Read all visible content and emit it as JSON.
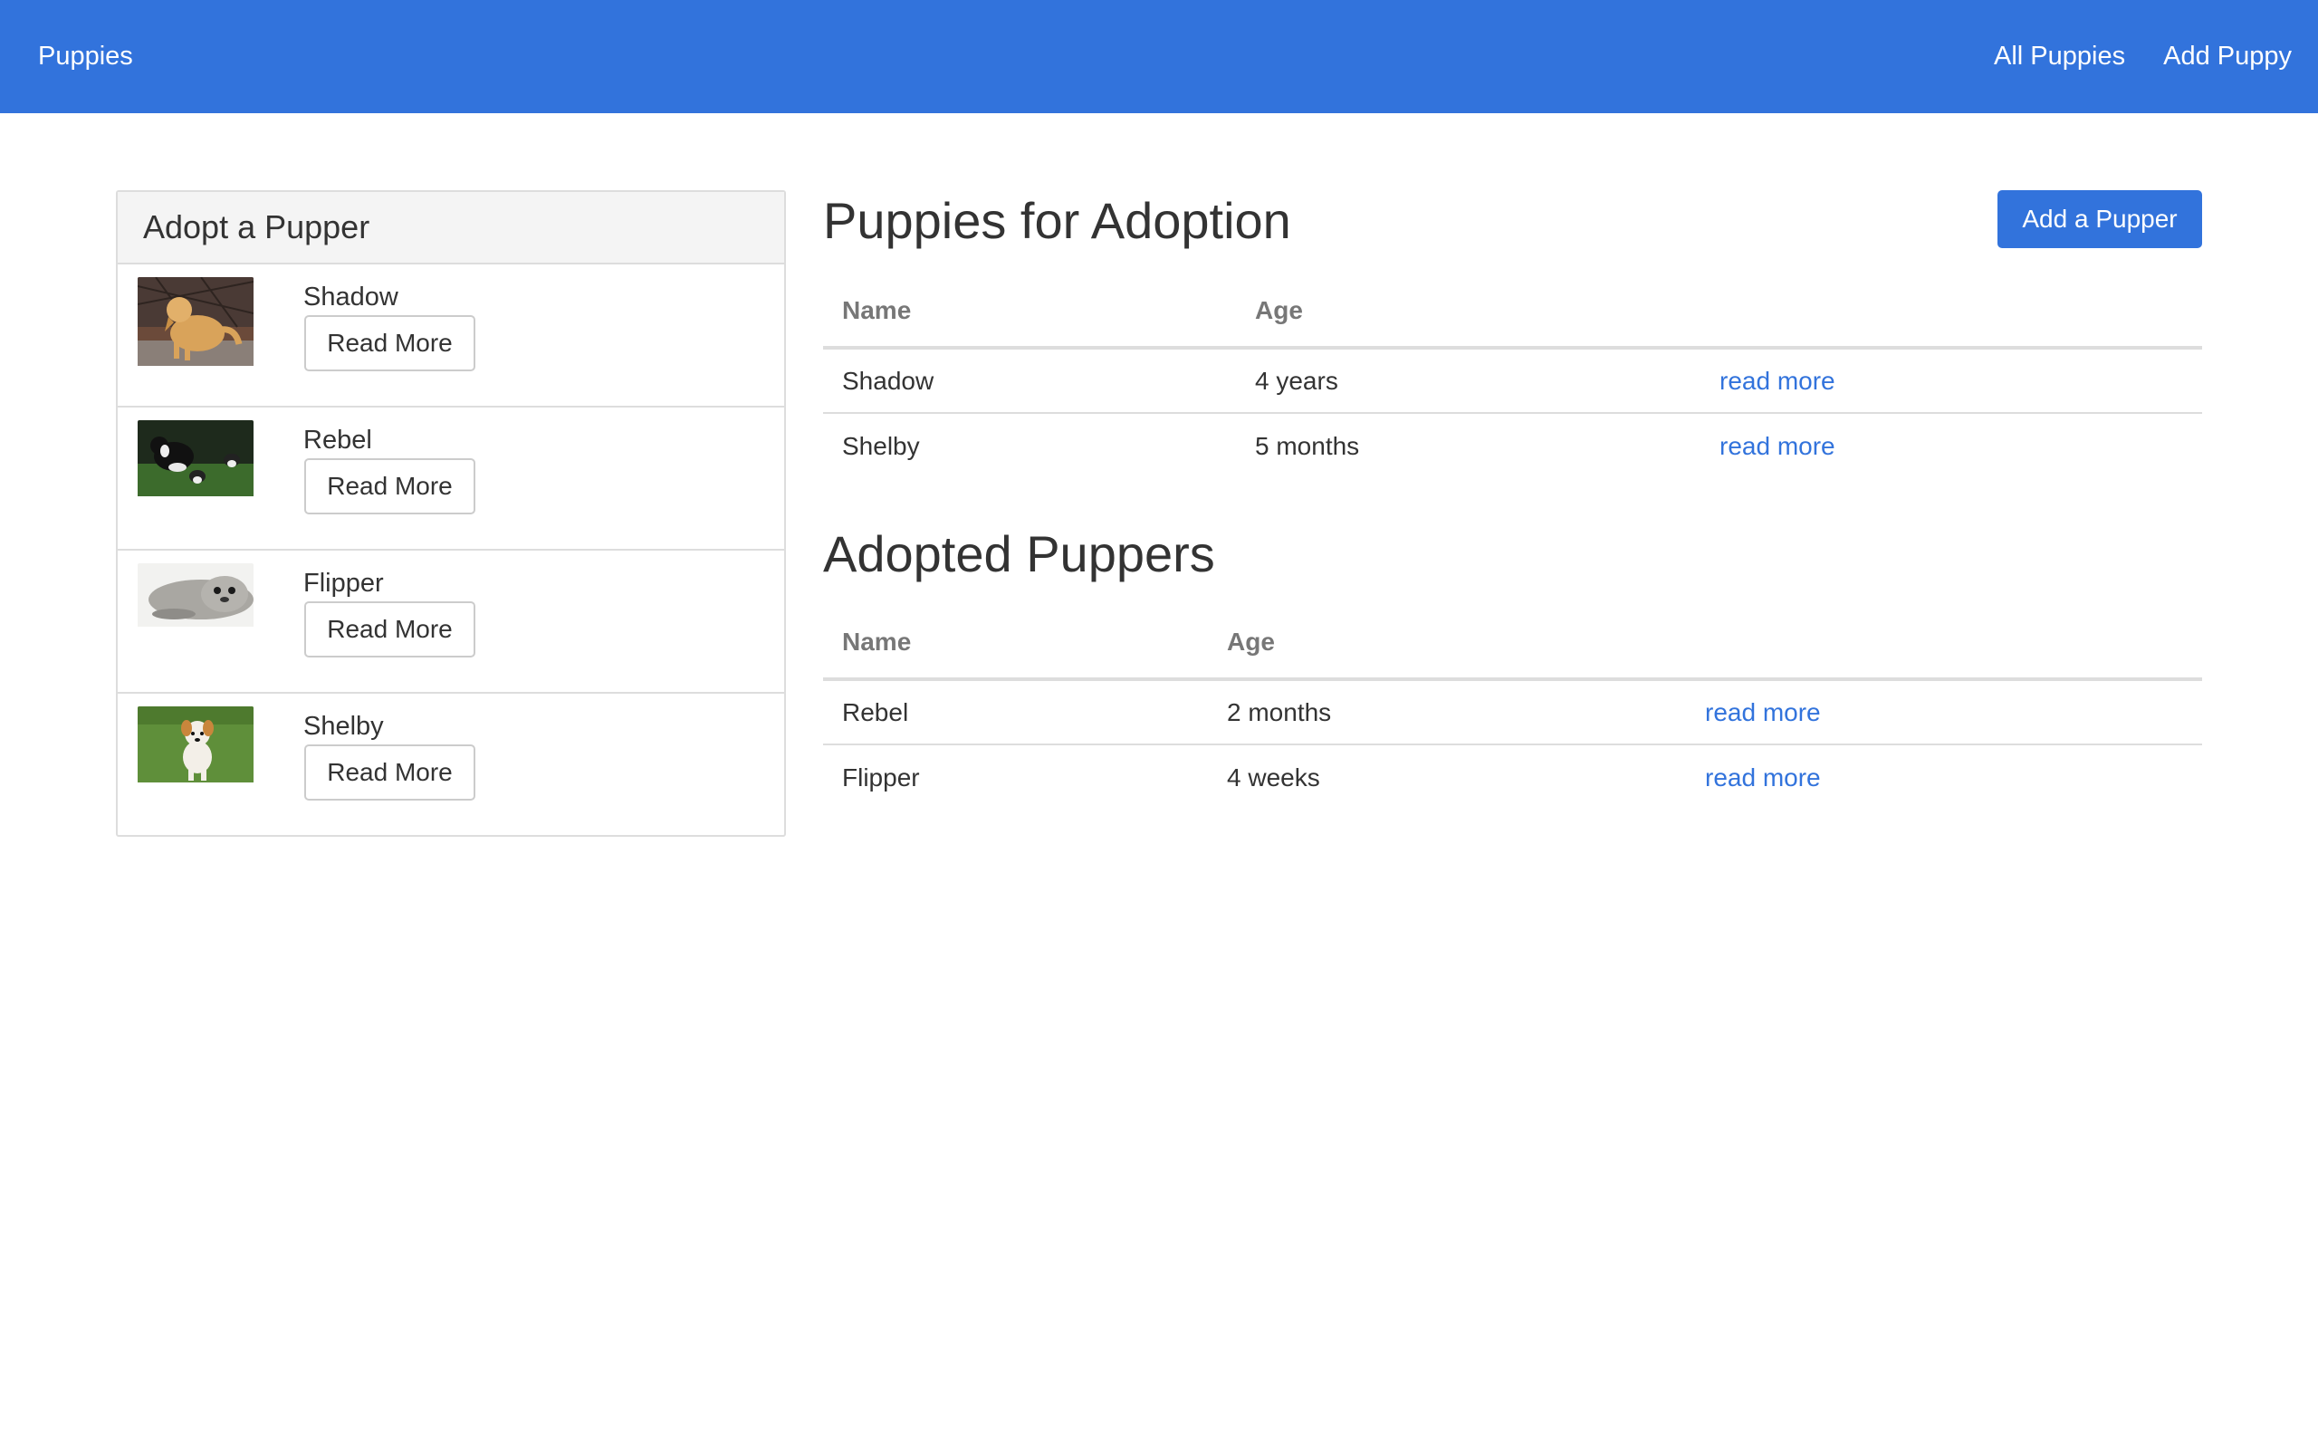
{
  "navbar": {
    "brand": "Puppies",
    "links": [
      "All Puppies",
      "Add Puppy"
    ],
    "background": "#3273dc"
  },
  "sidebar": {
    "title": "Adopt a Pupper",
    "items": [
      {
        "name": "Shadow",
        "button": "Read More"
      },
      {
        "name": "Rebel",
        "button": "Read More"
      },
      {
        "name": "Flipper",
        "button": "Read More"
      },
      {
        "name": "Shelby",
        "button": "Read More"
      }
    ]
  },
  "for_adoption": {
    "title": "Puppies for Adoption",
    "add_button": "Add a Pupper",
    "columns": [
      "Name",
      "Age"
    ],
    "rows": [
      {
        "name": "Shadow",
        "age": "4 years",
        "link": "read more"
      },
      {
        "name": "Shelby",
        "age": "5 months",
        "link": "read more"
      }
    ]
  },
  "adopted": {
    "title": "Adopted Puppers",
    "columns": [
      "Name",
      "Age"
    ],
    "rows": [
      {
        "name": "Rebel",
        "age": "2 months",
        "link": "read more"
      },
      {
        "name": "Flipper",
        "age": "4 weeks",
        "link": "read more"
      }
    ]
  },
  "colors": {
    "accent": "#3273dc",
    "border": "#dddddd",
    "muted": "#777777"
  }
}
